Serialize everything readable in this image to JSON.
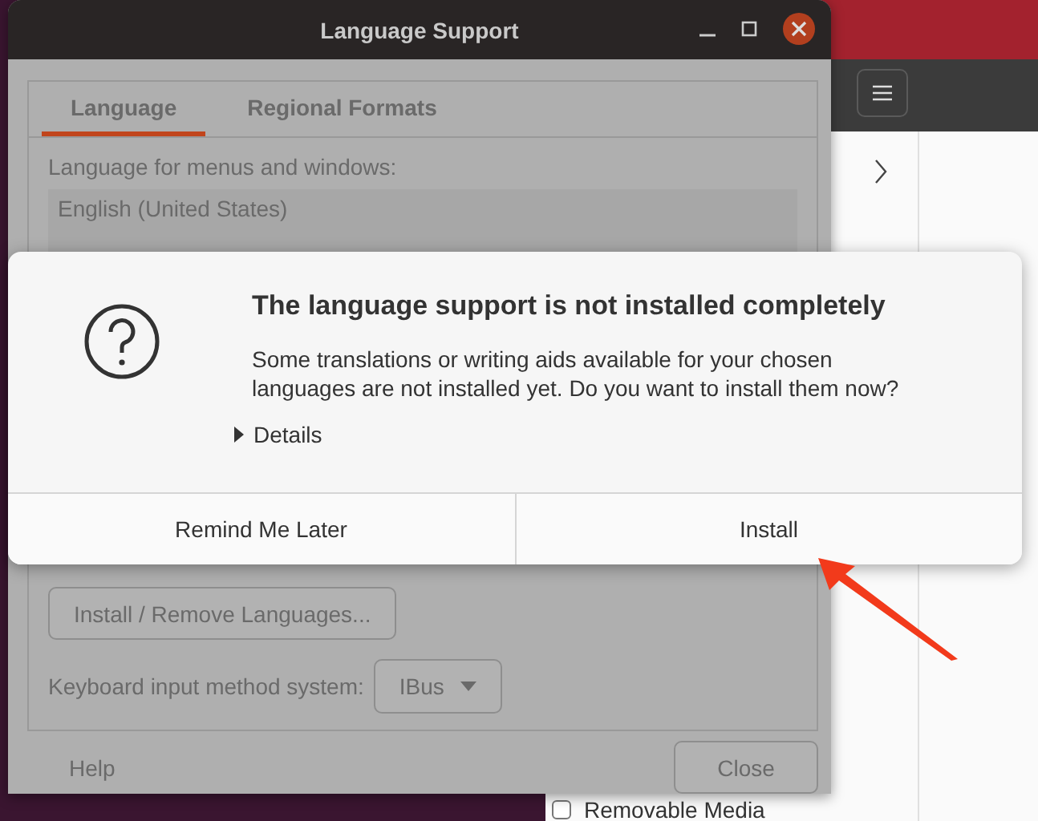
{
  "background_app": {
    "footer_item": {
      "label": "Removable Media",
      "checked": false
    }
  },
  "window": {
    "title": "Language Support"
  },
  "tabs": [
    {
      "label": "Language",
      "selected": true
    },
    {
      "label": "Regional Formats",
      "selected": false
    }
  ],
  "language_list": {
    "label": "Language for menus and windows:",
    "items": [
      "English (United States)"
    ]
  },
  "install_remove_button": "Install / Remove Languages...",
  "keyboard_input": {
    "label": "Keyboard input method system:",
    "value": "IBus"
  },
  "help": "Help",
  "close_button": "Close",
  "dialog": {
    "title": "The language support is not installed completely",
    "message": "Some translations or writing aids available for your chosen languages are not installed yet. Do you want to install them now?",
    "details": {
      "label": "Details",
      "expanded": false
    },
    "buttons": [
      "Remind Me Later",
      "Install"
    ]
  }
}
